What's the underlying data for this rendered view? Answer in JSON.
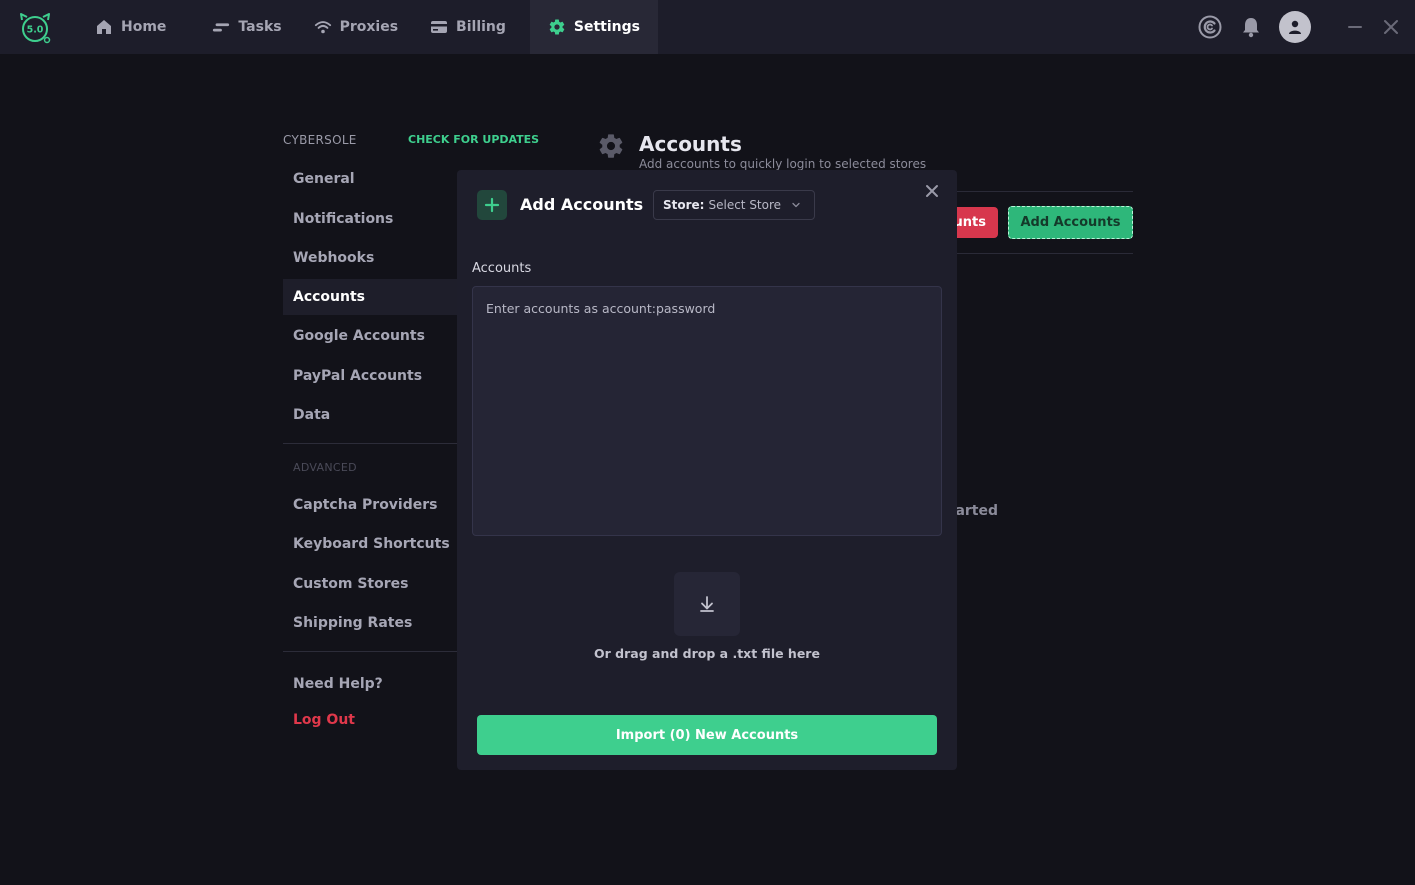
{
  "app": {
    "logo_text": "5.0"
  },
  "nav": {
    "items": [
      {
        "label": "Home",
        "icon": "home-icon"
      },
      {
        "label": "Tasks",
        "icon": "tasks-icon"
      },
      {
        "label": "Proxies",
        "icon": "wifi-icon"
      },
      {
        "label": "Billing",
        "icon": "billing-icon"
      },
      {
        "label": "Settings",
        "icon": "gear-icon",
        "active": true
      }
    ]
  },
  "sidebar": {
    "heading": "CYBERSOLE",
    "update_link": "CHECK FOR UPDATES",
    "items": [
      {
        "label": "General"
      },
      {
        "label": "Notifications"
      },
      {
        "label": "Webhooks"
      },
      {
        "label": "Accounts",
        "active": true
      },
      {
        "label": "Google Accounts"
      },
      {
        "label": "PayPal Accounts"
      },
      {
        "label": "Data"
      }
    ],
    "advanced_heading": "ADVANCED",
    "advanced_items": [
      {
        "label": "Captcha Providers"
      },
      {
        "label": "Keyboard Shortcuts"
      },
      {
        "label": "Custom Stores"
      },
      {
        "label": "Shipping Rates"
      }
    ],
    "help": "Need Help?",
    "logout": "Log Out"
  },
  "main": {
    "title": "Accounts",
    "subtitle": "Add accounts to quickly login to selected stores",
    "red_button": "unts",
    "green_button": "Add Accounts",
    "empty_hint": "arted"
  },
  "modal": {
    "title": "Add Accounts",
    "store_label": "Store:",
    "store_value": "Select Store",
    "accounts_label": "Accounts",
    "accounts_placeholder": "Enter accounts as account:password",
    "accounts_value": "",
    "drop_text": "Or drag and drop a .txt file here",
    "import_button": "Import (0) New Accounts"
  },
  "colors": {
    "accent_green": "#3ecf8e",
    "danger_red": "#e0384b",
    "background": "#121219",
    "topbar": "#1d1d2a"
  }
}
